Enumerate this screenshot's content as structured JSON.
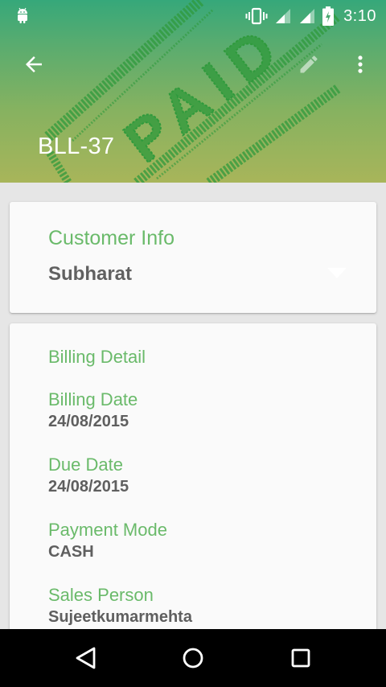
{
  "status_bar": {
    "time": "3:10",
    "icons": [
      "android-icon",
      "vibrate-icon",
      "signal-icon",
      "signal-icon",
      "battery-charging-icon"
    ]
  },
  "app_bar": {
    "back_icon": "arrow-back-icon",
    "edit_icon": "pencil-icon",
    "more_icon": "more-vert-icon"
  },
  "header": {
    "bill_id": "BLL-37",
    "stamp_text": "PAID"
  },
  "customer_card": {
    "title": "Customer Info",
    "name": "Subharat",
    "dropdown_icon": "triangle-down-icon"
  },
  "billing_card": {
    "title": "Billing Detail",
    "fields": [
      {
        "label": "Billing Date",
        "value": "24/08/2015"
      },
      {
        "label": "Due Date",
        "value": "24/08/2015"
      },
      {
        "label": "Payment Mode",
        "value": "CASH"
      },
      {
        "label": "Sales Person",
        "value": "Sujeetkumarmehta"
      }
    ]
  },
  "nav_bar": {
    "icons": [
      "nav-back-icon",
      "nav-home-icon",
      "nav-recent-icon"
    ]
  },
  "colors": {
    "accent_green": "#6aba6a",
    "header_top": "#36a87a",
    "header_bottom": "#a8b55a",
    "stamp_green": "#2f9a3c",
    "value_text": "#5f5f5f",
    "background": "#e6e6e6",
    "card": "#fafafa"
  }
}
